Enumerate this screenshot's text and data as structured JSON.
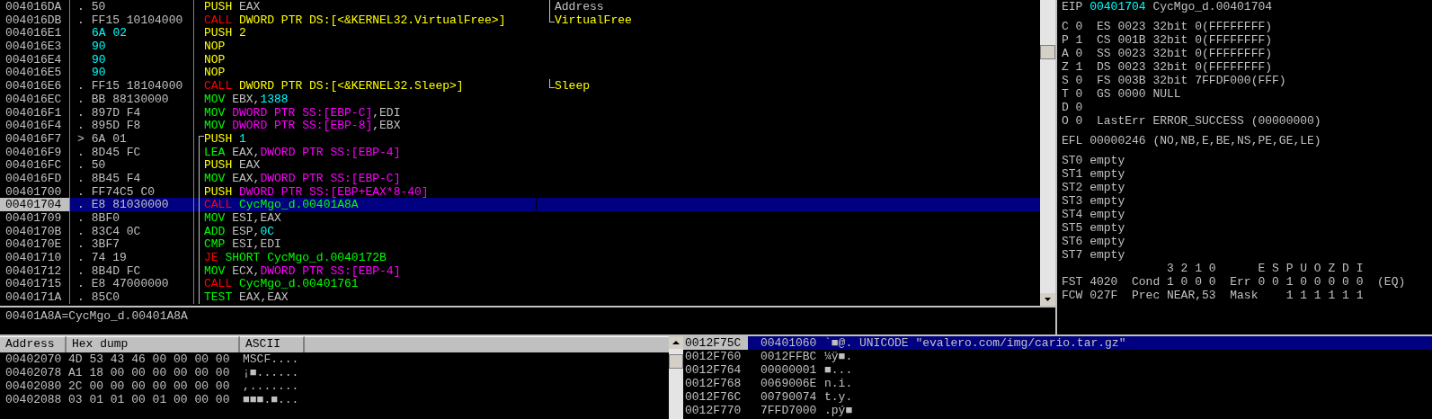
{
  "disassembly": {
    "rows": [
      {
        "address": "004016DA",
        "marker": ".",
        "hex": "50",
        "highlighted": false,
        "selected": false,
        "jump_start": false,
        "jump_line": false,
        "instruction": [
          {
            "text": "PUSH",
            "kind": "push"
          },
          {
            "text": " EAX",
            "kind": "plain"
          }
        ],
        "comment": {
          "text": "Address",
          "kind": "arg",
          "bracket_end": false
        }
      },
      {
        "address": "004016DB",
        "marker": ".",
        "hex": "FF15 10104000",
        "highlighted": false,
        "selected": false,
        "jump_start": false,
        "jump_line": false,
        "instruction": [
          {
            "text": "CALL",
            "kind": "jump"
          },
          {
            "text": " DWORD PTR DS:[<&KERNEL32.VirtualFree>]",
            "kind": "api"
          }
        ],
        "comment": {
          "text": "VirtualFree",
          "kind": "api",
          "bracket_end": true
        }
      },
      {
        "address": "004016E1",
        "hex": "6A 02",
        "highlighted": true,
        "selected": false,
        "jump_start": false,
        "jump_line": false,
        "instruction": [
          {
            "text": "PUSH 2",
            "kind": "push"
          }
        ]
      },
      {
        "address": "004016E3",
        "hex": "90",
        "highlighted": true,
        "selected": false,
        "jump_start": false,
        "jump_line": false,
        "instruction": [
          {
            "text": "NOP",
            "kind": "push"
          }
        ]
      },
      {
        "address": "004016E4",
        "hex": "90",
        "highlighted": true,
        "selected": false,
        "jump_start": false,
        "jump_line": false,
        "instruction": [
          {
            "text": "NOP",
            "kind": "push"
          }
        ]
      },
      {
        "address": "004016E5",
        "hex": "90",
        "highlighted": true,
        "selected": false,
        "jump_start": false,
        "jump_line": false,
        "instruction": [
          {
            "text": "NOP",
            "kind": "push"
          }
        ]
      },
      {
        "address": "004016E6",
        "marker": ".",
        "hex": "FF15 18104000",
        "highlighted": false,
        "selected": false,
        "jump_start": false,
        "jump_line": false,
        "instruction": [
          {
            "text": "CALL",
            "kind": "jump"
          },
          {
            "text": " DWORD PTR DS:[<&KERNEL32.Sleep>]",
            "kind": "api"
          }
        ],
        "comment": {
          "text": "Sleep",
          "kind": "api",
          "bracket_end": true
        }
      },
      {
        "address": "004016EC",
        "marker": ".",
        "hex": "BB 88130000",
        "highlighted": false,
        "selected": false,
        "jump_start": false,
        "jump_line": false,
        "instruction": [
          {
            "text": "MOV",
            "kind": "op"
          },
          {
            "text": " EBX,",
            "kind": "plain"
          },
          {
            "text": "1388",
            "kind": "const"
          }
        ]
      },
      {
        "address": "004016F1",
        "marker": ".",
        "hex": "897D F4",
        "highlighted": false,
        "selected": false,
        "jump_start": false,
        "jump_line": false,
        "instruction": [
          {
            "text": "MOV",
            "kind": "op"
          },
          {
            "text": " DWORD PTR SS:[EBP-C]",
            "kind": "mem"
          },
          {
            "text": ",EDI",
            "kind": "plain"
          }
        ]
      },
      {
        "address": "004016F4",
        "marker": ".",
        "hex": "895D F8",
        "highlighted": false,
        "selected": false,
        "jump_start": false,
        "jump_line": false,
        "instruction": [
          {
            "text": "MOV",
            "kind": "op"
          },
          {
            "text": " DWORD PTR SS:[EBP-8]",
            "kind": "mem"
          },
          {
            "text": ",EBX",
            "kind": "plain"
          }
        ]
      },
      {
        "address": "004016F7",
        "marker": ">",
        "hex": "6A 01",
        "highlighted": false,
        "selected": false,
        "jump_start": true,
        "jump_line": true,
        "instruction": [
          {
            "text": "PUSH",
            "kind": "push"
          },
          {
            "text": " 1",
            "kind": "const"
          }
        ]
      },
      {
        "address": "004016F9",
        "marker": ".",
        "hex": "8D45 FC",
        "highlighted": false,
        "selected": false,
        "jump_start": false,
        "jump_line": true,
        "instruction": [
          {
            "text": "LEA",
            "kind": "op"
          },
          {
            "text": " EAX,",
            "kind": "plain"
          },
          {
            "text": "DWORD PTR SS:[EBP-4]",
            "kind": "mem"
          }
        ]
      },
      {
        "address": "004016FC",
        "marker": ".",
        "hex": "50",
        "highlighted": false,
        "selected": false,
        "jump_start": false,
        "jump_line": true,
        "instruction": [
          {
            "text": "PUSH",
            "kind": "push"
          },
          {
            "text": " EAX",
            "kind": "plain"
          }
        ]
      },
      {
        "address": "004016FD",
        "marker": ".",
        "hex": "8B45 F4",
        "highlighted": false,
        "selected": false,
        "jump_start": false,
        "jump_line": true,
        "instruction": [
          {
            "text": "MOV",
            "kind": "op"
          },
          {
            "text": " EAX,",
            "kind": "plain"
          },
          {
            "text": "DWORD PTR SS:[EBP-C]",
            "kind": "mem"
          }
        ]
      },
      {
        "address": "00401700",
        "marker": ".",
        "hex": "FF74C5 C0",
        "highlighted": false,
        "selected": false,
        "jump_start": false,
        "jump_line": true,
        "instruction": [
          {
            "text": "PUSH",
            "kind": "push"
          },
          {
            "text": " DWORD PTR SS:[EBP+EAX*8-40]",
            "kind": "mem"
          }
        ]
      },
      {
        "address": "00401704",
        "marker": ".",
        "hex": "E8 81030000",
        "highlighted": false,
        "selected": true,
        "jump_start": false,
        "jump_line": true,
        "instruction": [
          {
            "text": "CALL",
            "kind": "jump"
          },
          {
            "text": " CycMgo_d.00401A8A",
            "kind": "op"
          }
        ]
      },
      {
        "address": "00401709",
        "marker": ".",
        "hex": "8BF0",
        "highlighted": false,
        "selected": false,
        "jump_start": false,
        "jump_line": true,
        "instruction": [
          {
            "text": "MOV",
            "kind": "op"
          },
          {
            "text": " ESI,EAX",
            "kind": "plain"
          }
        ]
      },
      {
        "address": "0040170B",
        "marker": ".",
        "hex": "83C4 0C",
        "highlighted": false,
        "selected": false,
        "jump_start": false,
        "jump_line": true,
        "instruction": [
          {
            "text": "ADD",
            "kind": "op"
          },
          {
            "text": " ESP,",
            "kind": "plain"
          },
          {
            "text": "0C",
            "kind": "const"
          }
        ]
      },
      {
        "address": "0040170E",
        "marker": ".",
        "hex": "3BF7",
        "highlighted": false,
        "selected": false,
        "jump_start": false,
        "jump_line": true,
        "instruction": [
          {
            "text": "CMP",
            "kind": "op"
          },
          {
            "text": " ESI,EDI",
            "kind": "plain"
          }
        ]
      },
      {
        "address": "00401710",
        "marker": ".",
        "hex": "74 19",
        "highlighted": false,
        "selected": false,
        "jump_start": false,
        "jump_line": true,
        "instruction": [
          {
            "text": "JE",
            "kind": "jump"
          },
          {
            "text": " SHORT CycMgo_d.0040172B",
            "kind": "op"
          }
        ]
      },
      {
        "address": "00401712",
        "marker": ".",
        "hex": "8B4D FC",
        "highlighted": false,
        "selected": false,
        "jump_start": false,
        "jump_line": true,
        "instruction": [
          {
            "text": "MOV",
            "kind": "op"
          },
          {
            "text": " ECX,",
            "kind": "plain"
          },
          {
            "text": "DWORD PTR SS:[EBP-4]",
            "kind": "mem"
          }
        ]
      },
      {
        "address": "00401715",
        "marker": ".",
        "hex": "E8 47000000",
        "highlighted": false,
        "selected": false,
        "jump_start": false,
        "jump_line": true,
        "instruction": [
          {
            "text": "CALL",
            "kind": "jump"
          },
          {
            "text": " CycMgo_d.00401761",
            "kind": "op"
          }
        ]
      },
      {
        "address": "0040171A",
        "marker": ".",
        "hex": "85C0",
        "highlighted": false,
        "selected": false,
        "jump_start": false,
        "jump_line": true,
        "instruction": [
          {
            "text": "TEST",
            "kind": "op"
          },
          {
            "text": " EAX,EAX",
            "kind": "plain"
          }
        ]
      }
    ]
  },
  "info": "00401A8A=CycMgo_d.00401A8A",
  "registers": {
    "groups": [
      {
        "lines": [
          [
            {
              "text": "EIP ",
              "kind": "plain"
            },
            {
              "text": "00401704",
              "kind": "const"
            },
            {
              "text": " CycMgo_d.00401704",
              "kind": "plain"
            }
          ]
        ]
      },
      {
        "lines": [
          [
            {
              "text": "C 0  ES 0023 32bit 0(FFFFFFFF)",
              "kind": "plain"
            }
          ],
          [
            {
              "text": "P 1  CS 001B 32bit 0(FFFFFFFF)",
              "kind": "plain"
            }
          ],
          [
            {
              "text": "A 0  SS 0023 32bit 0(FFFFFFFF)",
              "kind": "plain"
            }
          ],
          [
            {
              "text": "Z 1  DS 0023 32bit 0(FFFFFFFF)",
              "kind": "plain"
            }
          ],
          [
            {
              "text": "S 0  FS 003B 32bit 7FFDF000(FFF)",
              "kind": "plain"
            }
          ],
          [
            {
              "text": "T 0  GS 0000 NULL",
              "kind": "plain"
            }
          ],
          [
            {
              "text": "D 0",
              "kind": "plain"
            }
          ],
          [
            {
              "text": "O 0  LastErr ERROR_SUCCESS (00000000)",
              "kind": "plain"
            }
          ]
        ]
      },
      {
        "lines": [
          [
            {
              "text": "EFL 00000246 (NO,NB,E,BE,NS,PE,GE,LE)",
              "kind": "plain"
            }
          ]
        ]
      },
      {
        "lines": [
          [
            {
              "text": "ST0 empty",
              "kind": "plain"
            }
          ],
          [
            {
              "text": "ST1 empty",
              "kind": "plain"
            }
          ],
          [
            {
              "text": "ST2 empty",
              "kind": "plain"
            }
          ],
          [
            {
              "text": "ST3 empty",
              "kind": "plain"
            }
          ],
          [
            {
              "text": "ST4 empty",
              "kind": "plain"
            }
          ],
          [
            {
              "text": "ST5 empty",
              "kind": "plain"
            }
          ],
          [
            {
              "text": "ST6 empty",
              "kind": "plain"
            }
          ],
          [
            {
              "text": "ST7 empty",
              "kind": "plain"
            }
          ],
          [
            {
              "text": "               3 2 1 0      E S P U O Z D I",
              "kind": "plain"
            }
          ],
          [
            {
              "text": "FST 4020  Cond 1 0 0 0  Err 0 0 1 0 0 0 0 0  (EQ)",
              "kind": "plain"
            }
          ],
          [
            {
              "text": "FCW 027F  Prec NEAR,53  Mask    1 1 1 1 1 1",
              "kind": "plain"
            }
          ]
        ]
      }
    ]
  },
  "dump": {
    "columns": [
      "Address",
      "Hex dump",
      "ASCII"
    ],
    "rows": [
      {
        "address": "00402070",
        "hex": "4D 53 43 46 00 00 00 00",
        "ascii": "MSCF...."
      },
      {
        "address": "00402078",
        "hex": "A1 18 00 00 00 00 00 00",
        "ascii": "¡■......"
      },
      {
        "address": "00402080",
        "hex": "2C 00 00 00 00 00 00 00",
        "ascii": ",......."
      },
      {
        "address": "00402088",
        "hex": "03 01 01 00 01 00 00 00",
        "ascii": "■■■.■..."
      }
    ]
  },
  "stack": {
    "rows": [
      {
        "address": "0012F75C",
        "value": "00401060",
        "comment": "`■@. UNICODE \"evalero.com/img/cario.tar.gz\"",
        "selected": true
      },
      {
        "address": "0012F760",
        "value": "0012FFBC",
        "comment": "¼ÿ■.",
        "selected": false
      },
      {
        "address": "0012F764",
        "value": "00000001",
        "comment": "■...",
        "selected": false
      },
      {
        "address": "0012F768",
        "value": "0069006E",
        "comment": "n.i.",
        "selected": false
      },
      {
        "address": "0012F76C",
        "value": "00790074",
        "comment": "t.y.",
        "selected": false
      },
      {
        "address": "0012F770",
        "value": "7FFD7000",
        "comment": ".pý■",
        "selected": false
      }
    ]
  }
}
